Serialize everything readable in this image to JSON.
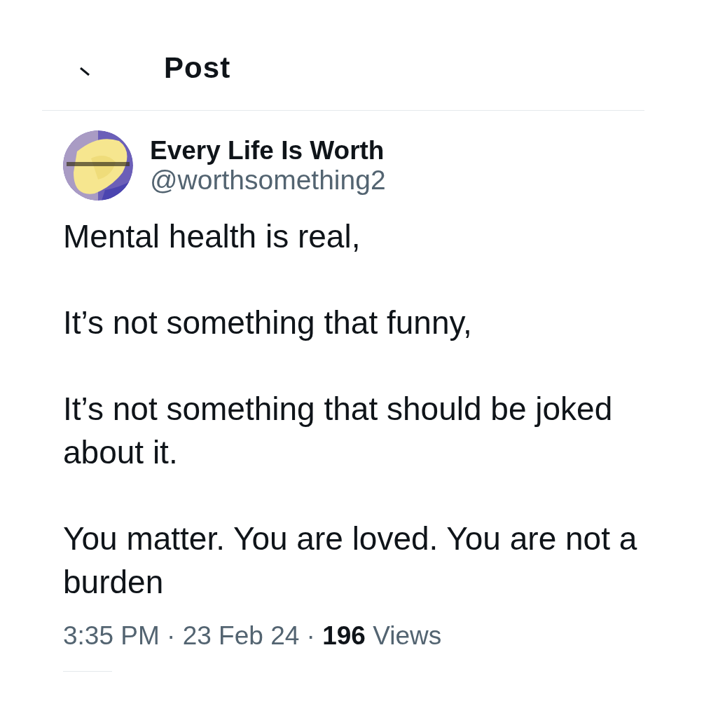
{
  "header": {
    "title": "Post"
  },
  "post": {
    "author": {
      "name": "Every Life Is Worth",
      "handle": "@worthsomething2"
    },
    "paragraphs": [
      "Mental health is real,",
      "It’s not something that funny,",
      "It’s not something that should be joked about it.",
      "You matter. You are loved. You are not a burden"
    ],
    "meta": "3:35 PM · 23 Feb 24 · **196** Views"
  }
}
